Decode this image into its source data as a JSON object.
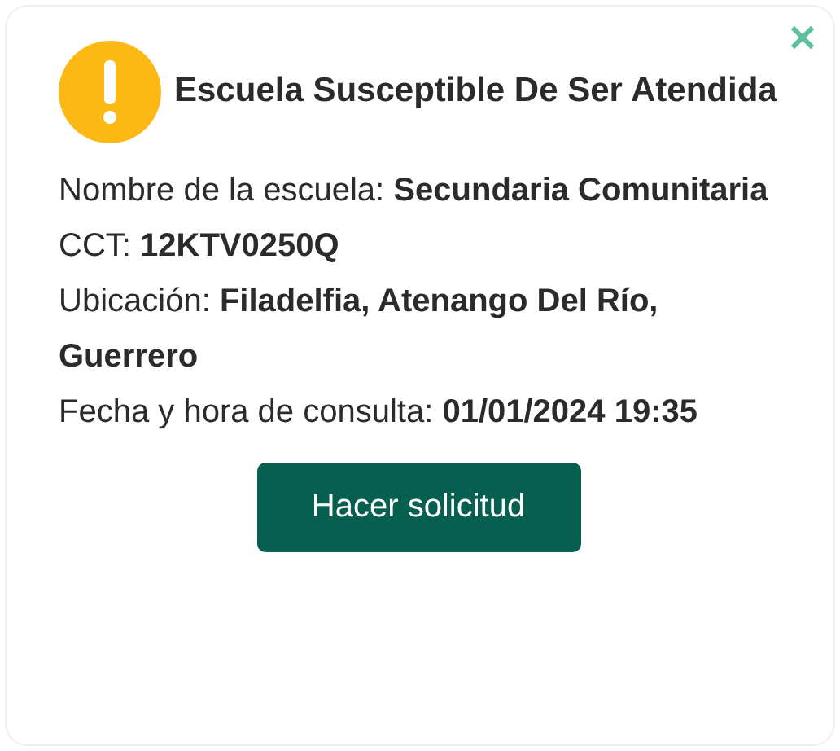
{
  "title": "Escuela Susceptible De Ser Atendida",
  "fields": [
    {
      "label": "Nombre de la escuela:",
      "value": "Secundaria Comunitaria"
    },
    {
      "label": "CCT:",
      "value": "12KTV0250Q"
    },
    {
      "label": "Ubicación:",
      "value": "Filadelfia, Atenango Del Río, Guerrero"
    },
    {
      "label": "Fecha y hora de consulta:",
      "value": "01/01/2024 19:35"
    }
  ],
  "button": "Hacer solicitud"
}
